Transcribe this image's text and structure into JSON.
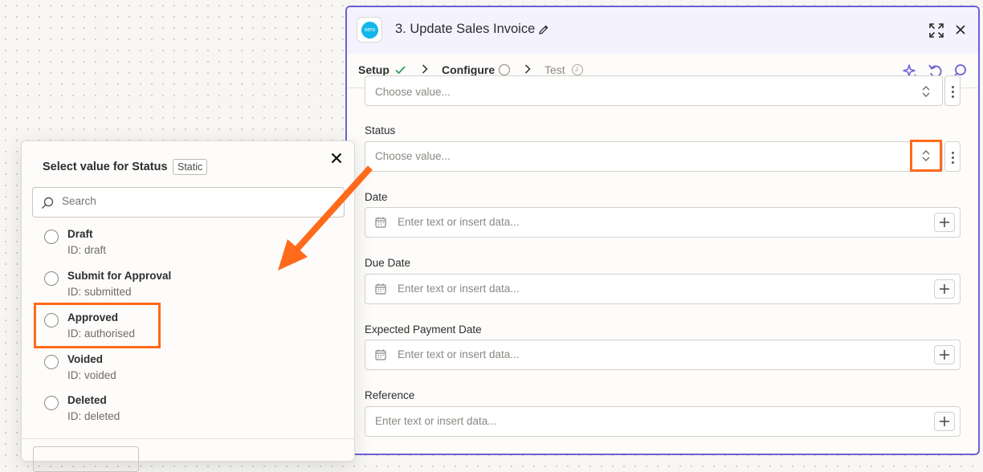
{
  "step": {
    "app_icon_text": "xero",
    "title": "3. Update Sales Invoice",
    "tabs": [
      {
        "label": "Setup",
        "state": "complete"
      },
      {
        "label": "Configure",
        "state": "active"
      },
      {
        "label": "Test",
        "state": "pending"
      }
    ],
    "fields": {
      "top_placeholder": "Choose value...",
      "status": {
        "label": "Status",
        "placeholder": "Choose value..."
      },
      "date": {
        "label": "Date",
        "placeholder": "Enter text or insert data..."
      },
      "due_date": {
        "label": "Due Date",
        "placeholder": "Enter text or insert data..."
      },
      "expected_payment_date": {
        "label": "Expected Payment Date",
        "placeholder": "Enter text or insert data..."
      },
      "reference": {
        "label": "Reference",
        "placeholder": "Enter text or insert data..."
      }
    }
  },
  "popover": {
    "title": "Select value for Status",
    "badge": "Static",
    "search_placeholder": "Search",
    "options": [
      {
        "label": "Draft",
        "id_text": "ID: draft"
      },
      {
        "label": "Submit for Approval",
        "id_text": "ID: submitted"
      },
      {
        "label": "Approved",
        "id_text": "ID: authorised"
      },
      {
        "label": "Voided",
        "id_text": "ID: voided"
      },
      {
        "label": "Deleted",
        "id_text": "ID: deleted"
      }
    ]
  },
  "colors": {
    "accent": "#6e5fd6",
    "highlight": "#ff6a1b",
    "success": "#2e9e5b",
    "xero_blue": "#13b5ea"
  }
}
